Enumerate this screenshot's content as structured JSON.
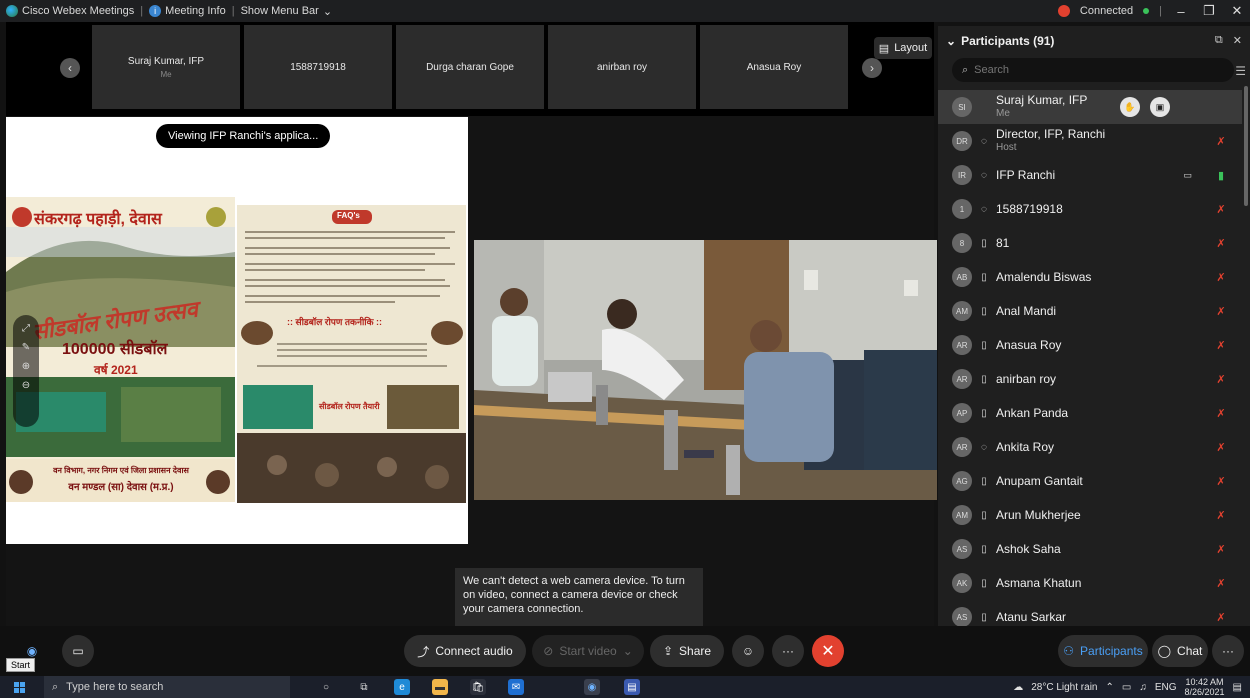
{
  "titlebar": {
    "app_name": "Cisco Webex Meetings",
    "meeting_info": "Meeting Info",
    "menu_bar": "Show Menu Bar",
    "status": "Connected"
  },
  "filmstrip": {
    "tiles": [
      {
        "name": "Suraj Kumar, IFP",
        "sub": "Me"
      },
      {
        "name": "1588719918",
        "sub": ""
      },
      {
        "name": "Durga charan Gope",
        "sub": ""
      },
      {
        "name": "anirban roy",
        "sub": ""
      },
      {
        "name": "Anasua Roy",
        "sub": ""
      }
    ],
    "layout_label": "Layout"
  },
  "share": {
    "viewing_label": "Viewing IFP Ranchi's applica...",
    "poster_title": "संकरगढ़ पहाड़ी, देवास",
    "poster_event": "सीडबॉल रोपण उत्सव",
    "poster_count": "100000 सीडबॉल",
    "poster_year": "वर्ष 2021",
    "poster_org": "वन विभाग, नगर निगम एवं जिला प्रशासन देवास",
    "poster_org2": "वन मण्डल (सा) देवास (म.प्र.)",
    "faq_title": "FAQ's",
    "faq_sub": ":: सीडबॉल रोपण तकनीकि ::",
    "faq_photo_caption": "सीडबॉल रोपण तैयारी"
  },
  "toast": {
    "message": "We can't detect a web camera device. To turn on video, connect a camera device or check your camera connection."
  },
  "participants": {
    "header": "Participants (91)",
    "search_placeholder": "Search",
    "rows": [
      {
        "initials": "SI",
        "name": "Suraj Kumar, IFP",
        "role": "Me",
        "mic": "none"
      },
      {
        "initials": "DR",
        "name": "Director, IFP, Ranchi",
        "role": "Host",
        "mic": "muted"
      },
      {
        "initials": "IR",
        "name": "IFP Ranchi",
        "role": "",
        "mic": "live"
      },
      {
        "initials": "1",
        "name": "1588719918",
        "role": "",
        "mic": "muted"
      },
      {
        "initials": "8",
        "name": "81",
        "role": "",
        "mic": "muted"
      },
      {
        "initials": "AB",
        "name": "Amalendu Biswas",
        "role": "",
        "mic": "muted"
      },
      {
        "initials": "AM",
        "name": "Anal Mandi",
        "role": "",
        "mic": "muted"
      },
      {
        "initials": "AR",
        "name": "Anasua Roy",
        "role": "",
        "mic": "muted"
      },
      {
        "initials": "AR",
        "name": "anirban roy",
        "role": "",
        "mic": "muted"
      },
      {
        "initials": "AP",
        "name": "Ankan Panda",
        "role": "",
        "mic": "muted"
      },
      {
        "initials": "AR",
        "name": "Ankita Roy",
        "role": "",
        "mic": "muted"
      },
      {
        "initials": "AG",
        "name": "Anupam Gantait",
        "role": "",
        "mic": "muted"
      },
      {
        "initials": "AM",
        "name": "Arun Mukherjee",
        "role": "",
        "mic": "muted"
      },
      {
        "initials": "AS",
        "name": "Ashok Saha",
        "role": "",
        "mic": "muted"
      },
      {
        "initials": "AK",
        "name": "Asmana Khatun",
        "role": "",
        "mic": "muted"
      },
      {
        "initials": "AS",
        "name": "Atanu Sarkar",
        "role": "",
        "mic": "muted"
      }
    ]
  },
  "controls": {
    "connect_audio": "Connect audio",
    "start_video": "Start video",
    "share": "Share",
    "participants": "Participants",
    "chat": "Chat",
    "start_tooltip": "Start"
  },
  "taskbar": {
    "search_placeholder": "Type here to search",
    "weather": "28°C  Light rain",
    "lang": "ENG",
    "time": "10:42 AM",
    "date": "8/26/2021"
  }
}
